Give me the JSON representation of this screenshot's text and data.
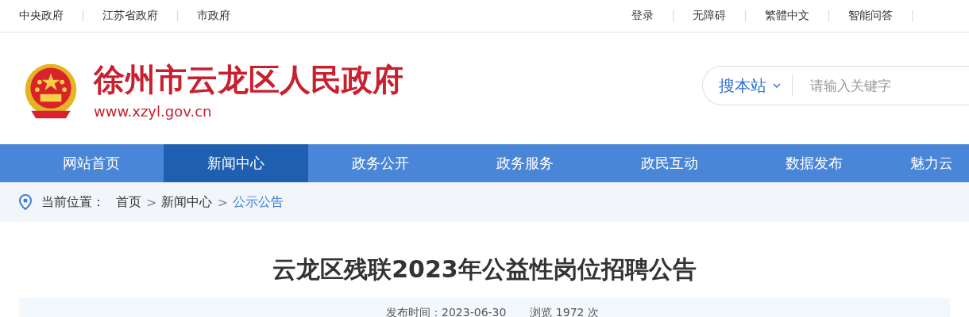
{
  "top_bar": {
    "left_links": [
      "中央政府",
      "江苏省政府",
      "市政府"
    ],
    "right_links": [
      "登录",
      "无障碍",
      "繁體中文",
      "智能问答"
    ]
  },
  "header": {
    "site_name": "徐州市云龙区人民政府",
    "site_url": "www.xzyl.gov.cn",
    "search": {
      "scope": "搜本站",
      "placeholder": "请输入关键字"
    }
  },
  "nav": [
    {
      "label": "网站首页",
      "selected": false
    },
    {
      "label": "新闻中心",
      "selected": true
    },
    {
      "label": "政务公开",
      "selected": false
    },
    {
      "label": "政务服务",
      "selected": false
    },
    {
      "label": "政民互动",
      "selected": false
    },
    {
      "label": "数据发布",
      "selected": false
    },
    {
      "label": "魅力云",
      "selected": false
    }
  ],
  "breadcrumb": {
    "label": "当前位置：",
    "separator": ">",
    "items": [
      "首页",
      "新闻中心",
      "公示公告"
    ]
  },
  "article": {
    "title": "云龙区残联2023年公益性岗位招聘公告",
    "published": "发布时间：2023-06-30",
    "views": "浏览 1972 次"
  }
}
